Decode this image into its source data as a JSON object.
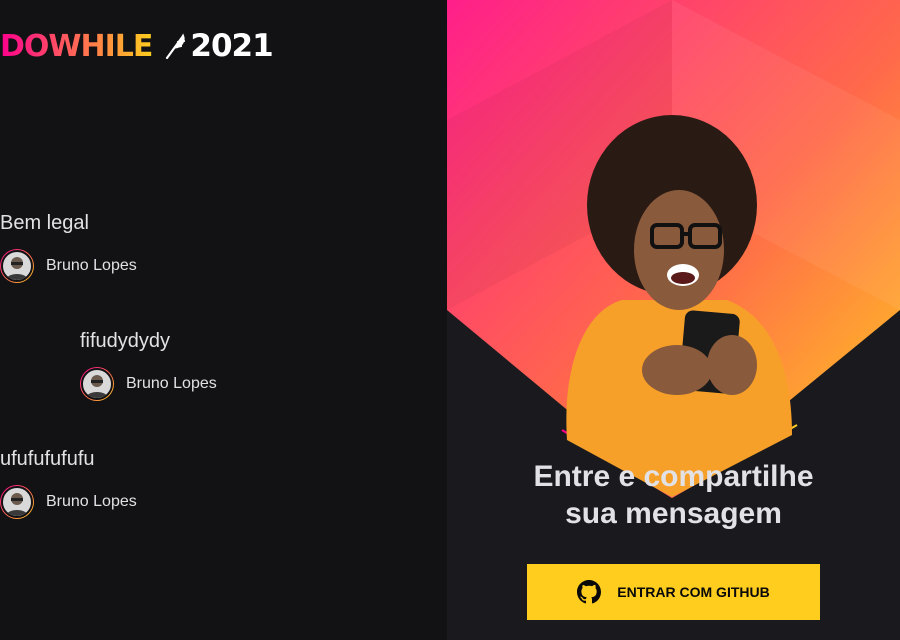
{
  "logo": {
    "brand": "DOWHILE",
    "year": "2021"
  },
  "messages": [
    {
      "text": "Bem legal",
      "user": "Bruno Lopes"
    },
    {
      "text": "fifudydydy",
      "user": "Bruno Lopes"
    },
    {
      "text": "ufufufufufu",
      "user": "Bruno Lopes"
    }
  ],
  "login": {
    "title_line1": "Entre e compartilhe",
    "title_line2": "sua mensagem",
    "button_label": "ENTRAR COM GITHUB"
  },
  "colors": {
    "background": "#121214",
    "accent_pink": "#ff008e",
    "accent_yellow": "#ffcd1e",
    "text": "#e1e1e6"
  },
  "icons": [
    "feather-icon",
    "github-icon",
    "avatar"
  ]
}
